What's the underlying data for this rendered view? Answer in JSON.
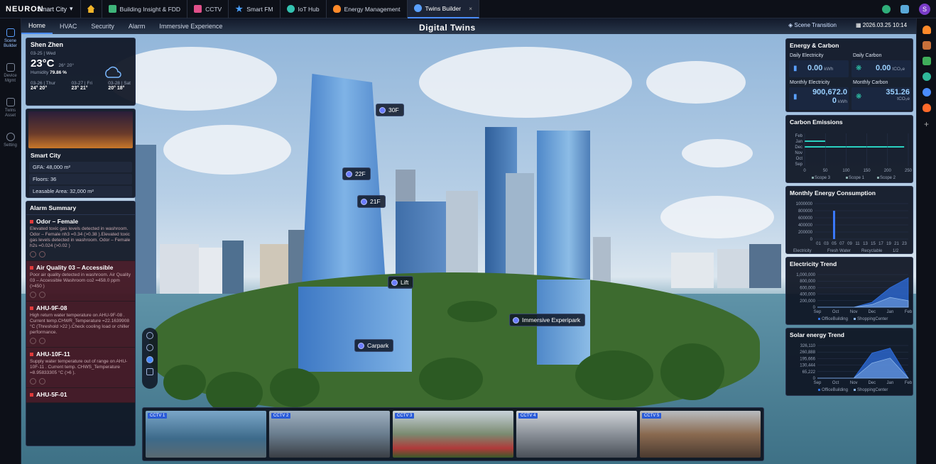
{
  "topbar": {
    "logo": "NEURON",
    "project": "Smart City",
    "tabs": [
      {
        "label": "Building Insight & FDD",
        "color": "#3fb47a"
      },
      {
        "label": "CCTV",
        "color": "#e0508a"
      },
      {
        "label": "Smart FM",
        "color": "#4aa0ff"
      },
      {
        "label": "IoT Hub",
        "color": "#33c2b0"
      },
      {
        "label": "Energy Management",
        "color": "#ff8a2a"
      },
      {
        "label": "Twins Builder",
        "color": "#5aa0ff",
        "active": true,
        "close": "×"
      }
    ],
    "avatar": "S"
  },
  "leftrail": [
    {
      "label": "Scene Builder",
      "active": true
    },
    {
      "label": "Device Mgmt"
    },
    {
      "label": "Twins Asset"
    },
    {
      "label": "Setting"
    }
  ],
  "subnav": {
    "items": [
      "Home",
      "HVAC",
      "Security",
      "Alarm",
      "Immersive Experience"
    ],
    "active": 0
  },
  "title": "Digital Twins",
  "scene_transition": "Scene Transition",
  "datetime": "2026.03.25 10:14",
  "weather": {
    "city": "Shen Zhen",
    "date": "03-25 | Wed",
    "temp": "23°C",
    "range": "26° 20°",
    "humidity_label": "Humidity",
    "humidity": "79.86 %",
    "forecast": [
      {
        "day": "03-26 | Thur",
        "t": "24° 20°"
      },
      {
        "day": "03-27 | Fri",
        "t": "23° 21°"
      },
      {
        "day": "03-28 | Sat",
        "t": "20° 18°"
      }
    ]
  },
  "building": {
    "name": "Smart City",
    "gfa": "GFA: 48,000 m²",
    "floors": "Floors: 36",
    "leasable": "Leasable Area: 32,000 m²"
  },
  "alarms": {
    "title": "Alarm Summary",
    "items": [
      {
        "title": "Odor – Female",
        "desc": "Elevated toxic gas levels detected in washroom. Odor – Female nh3 =0.34 (>0.38 ).Elevated toxic gas levels detected in washroom. Odor – Female h2s =0.024 (>0.02 )",
        "red": false
      },
      {
        "title": "Air Quality 03 – Accessible",
        "desc": "Poor air quality detected in washroom. Air Quality 03 – Accessible Washroom co2 =458.0 ppm (>450 )",
        "red": true
      },
      {
        "title": "AHU-9F-08",
        "desc": "High return water temperature on AHU-9F-08 . Current temp.CHWR_Temperature =22.1639908 °C (Threshold >22 ).Check cooling load or chiller performance.",
        "red": true
      },
      {
        "title": "AHU-10F-11",
        "desc": "Supply water temperature out of range on AHU-10F-11 . Current temp. CHWS_Temperature =8.95833305 °C (>6 ).",
        "red": true
      },
      {
        "title": "AHU-5F-01",
        "desc": "",
        "red": true
      }
    ]
  },
  "tags": [
    "30F",
    "22F",
    "21F",
    "Lift",
    "Carpark",
    "Immersive Experipark"
  ],
  "energy": {
    "title": "Energy & Carbon",
    "daily_elec": "Daily Electricity",
    "daily_elec_val": "0.00",
    "kwh": "kWh",
    "daily_carbon": "Daily Carbon",
    "daily_carbon_val": "0.00",
    "tco2e": "tCO₂e",
    "monthly_elec": "Monthly Electricity",
    "monthly_elec_val": "900,672.0",
    "monthly_elec_val2": "0",
    "monthly_carbon": "Monthly Carbon",
    "monthly_carbon_val": "351.26"
  },
  "chart_data": [
    {
      "type": "bar",
      "title": "Carbon Emissions",
      "categories": [
        "Feb",
        "Jan",
        "Dec",
        "Nov",
        "Oct",
        "Sep"
      ],
      "x_ticks": [
        "0",
        "50",
        "100",
        "150",
        "200",
        "250"
      ],
      "xlim": [
        0,
        250
      ],
      "series": [
        {
          "name": "Scope 3",
          "values": [
            0,
            0,
            0,
            0,
            0,
            0
          ]
        },
        {
          "name": "Scope 1",
          "values": [
            0,
            0,
            0,
            0,
            0,
            0
          ]
        },
        {
          "name": "Scope 2",
          "values": [
            0,
            50,
            240,
            0,
            0,
            0
          ]
        }
      ],
      "color": "#2ad0c0"
    },
    {
      "type": "bar",
      "title": "Monthly Energy Consumption",
      "categories": [
        "01",
        "03",
        "05",
        "07",
        "09",
        "11",
        "13",
        "15",
        "17",
        "19",
        "21",
        "23"
      ],
      "y_ticks": [
        "1000000",
        "800000",
        "600000",
        "400000",
        "200000",
        "0"
      ],
      "ylim": [
        0,
        1000000
      ],
      "series": [
        {
          "name": "Electricity",
          "values": [
            0,
            0,
            800000,
            0,
            0,
            0,
            0,
            0,
            0,
            0,
            0,
            0
          ]
        },
        {
          "name": "Fresh Water",
          "values": [
            0,
            0,
            0,
            0,
            0,
            0,
            0,
            0,
            0,
            0,
            0,
            0
          ]
        },
        {
          "name": "Recyclable",
          "values": [
            0,
            0,
            0,
            0,
            0,
            0,
            0,
            0,
            0,
            0,
            0,
            0
          ]
        }
      ],
      "page": "1/2"
    },
    {
      "type": "area",
      "title": "Electricity Trend",
      "categories": [
        "Sep",
        "Oct",
        "Nov",
        "Dec",
        "Jan",
        "Feb"
      ],
      "y_ticks": [
        "1,000,000",
        "800,000",
        "600,000",
        "400,000",
        "200,000",
        "0"
      ],
      "ylim": [
        0,
        1000000
      ],
      "series": [
        {
          "name": "OfficeBuilding",
          "values": [
            0,
            0,
            0,
            150000,
            600000,
            900000
          ]
        },
        {
          "name": "ShoppingCenter",
          "values": [
            0,
            0,
            0,
            80000,
            300000,
            200000
          ]
        }
      ]
    },
    {
      "type": "area",
      "title": "Solar energy Trend",
      "categories": [
        "Sep",
        "Oct",
        "Nov",
        "Dec",
        "Jan",
        "Feb"
      ],
      "y_ticks": [
        "326,110",
        "260,888",
        "195,666",
        "130,444",
        "65,222",
        "0"
      ],
      "ylim": [
        0,
        326110
      ],
      "series": [
        {
          "name": "OfficeBuilding",
          "values": [
            0,
            0,
            0,
            250000,
            300000,
            0
          ]
        },
        {
          "name": "ShoppingCenter",
          "values": [
            0,
            0,
            0,
            150000,
            200000,
            0
          ]
        }
      ]
    }
  ],
  "cctv": [
    "CCTV 1",
    "CCTV 2",
    "CCTV 3",
    "CCTV 4",
    "CCTV 5"
  ]
}
